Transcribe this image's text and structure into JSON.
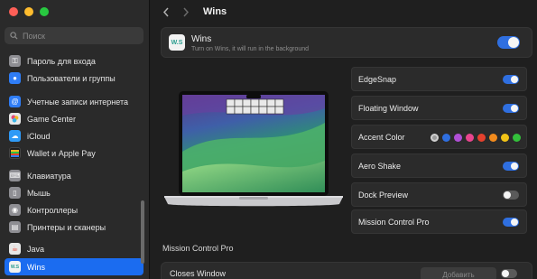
{
  "window": {
    "traffic_lights": [
      "#fe5f57",
      "#febc2e",
      "#28c840"
    ]
  },
  "search": {
    "placeholder": "Поиск"
  },
  "sidebar": {
    "items": [
      {
        "label": "Пароль для входа",
        "icon": "key-icon",
        "color": "#8e8e93"
      },
      {
        "label": "Пользователи и группы",
        "icon": "users-icon",
        "color": "#2f7df6"
      },
      {
        "label": "Учетные записи интернета",
        "icon": "at-icon",
        "color": "#2f7df6"
      },
      {
        "label": "Game Center",
        "icon": "gamecenter-icon",
        "color": "#e7e7e7"
      },
      {
        "label": "iCloud",
        "icon": "icloud-icon",
        "color": "#2f9af6"
      },
      {
        "label": "Wallet и Apple Pay",
        "icon": "wallet-icon",
        "color": "#1c1c1e"
      },
      {
        "label": "Клавиатура",
        "icon": "keyboard-icon",
        "color": "#8e8e93"
      },
      {
        "label": "Мышь",
        "icon": "mouse-icon",
        "color": "#8e8e93"
      },
      {
        "label": "Контроллеры",
        "icon": "controller-icon",
        "color": "#8e8e93"
      },
      {
        "label": "Принтеры и сканеры",
        "icon": "printer-icon",
        "color": "#8e8e93"
      },
      {
        "label": "Java",
        "icon": "java-icon",
        "color": "#e7e7e7"
      },
      {
        "label": "Wins",
        "icon": "wins-icon",
        "color": "#f2f2f2",
        "selected": true
      }
    ]
  },
  "toolbar": {
    "title": "Wins"
  },
  "app": {
    "icon_text": "W.S",
    "name": "Wins",
    "description": "Turn on Wins, it will run in the background",
    "enabled": true
  },
  "options": {
    "edge_snap": {
      "label": "EdgeSnap",
      "enabled": true
    },
    "floating_window": {
      "label": "Floating Window",
      "enabled": true
    },
    "accent_color": {
      "label": "Accent Color",
      "colors": [
        "#9a9a9a",
        "#2f6fe0",
        "#b04fd6",
        "#e9458e",
        "#e5412d",
        "#f28b1d",
        "#f2c417",
        "#33c13b"
      ]
    },
    "aero_shake": {
      "label": "Aero Shake",
      "enabled": true
    },
    "dock_preview": {
      "label": "Dock Preview",
      "enabled": false
    },
    "mission_control_pro": {
      "label": "Mission Control Pro",
      "enabled": true
    }
  },
  "section": {
    "title": "Mission Control Pro"
  },
  "closes_window": {
    "label": "Closes Window",
    "button_label": "Добавить",
    "enabled": false
  }
}
